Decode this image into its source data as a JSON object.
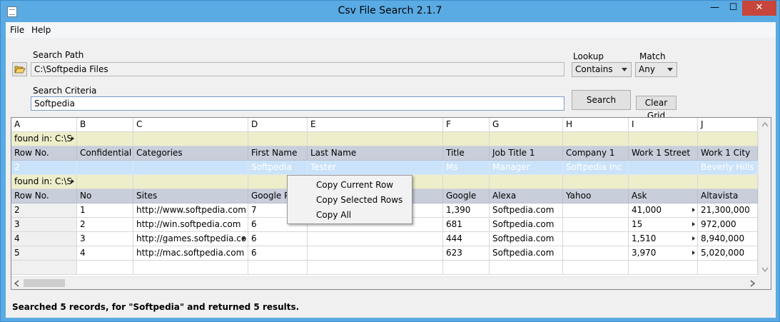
{
  "window": {
    "title": "Csv File Search 2.1.7",
    "min": "—",
    "max": "☐",
    "close": "✕"
  },
  "menu": [
    "File",
    "Help"
  ],
  "search_path": {
    "label": "Search Path",
    "value": "C:\\Softpedia Files"
  },
  "search_criteria": {
    "label": "Search Criteria",
    "value": "Softpedia"
  },
  "lookup": {
    "label": "Lookup",
    "value": "Contains"
  },
  "match": {
    "label": "Match",
    "value": "Any"
  },
  "buttons": {
    "search": "Search",
    "clear_grid": "Clear Grid"
  },
  "grid": {
    "column_letters": [
      "A",
      "B",
      "C",
      "D",
      "E",
      "F",
      "G",
      "H",
      "I",
      "J"
    ],
    "group1": {
      "label": "found in: C:\\S",
      "headers": [
        "Row No.",
        "Confidential",
        "Categories",
        "First Name",
        "Last Name",
        "Title",
        "Job Title 1",
        "Company 1",
        "Work 1 Street",
        "Work 1 City"
      ],
      "rows": [
        [
          "2",
          "",
          "",
          "Softpedia",
          "Tester",
          "Ms",
          "Manager",
          "Softpedia Inc",
          "",
          "Beverly Hills"
        ]
      ]
    },
    "group2": {
      "label": "found in: C:\\S",
      "headers": [
        "Row No.",
        "No",
        "Sites",
        "Google PR",
        "",
        "Google",
        "Alexa",
        "Yahoo",
        "Ask",
        "Altavista"
      ],
      "rows": [
        [
          "2",
          "1",
          "http://www.softpedia.com",
          "7",
          "",
          "1,390",
          "Softpedia.com",
          "",
          "41,000",
          "21,300,000"
        ],
        [
          "3",
          "2",
          "http://win.softpedia.com",
          "6",
          "",
          "681",
          "Softpedia.com",
          "",
          "15",
          "972,000"
        ],
        [
          "4",
          "3",
          "http://games.softpedia.co",
          "6",
          "",
          "444",
          "Softpedia.com",
          "",
          "1,510",
          "8,940,000"
        ],
        [
          "5",
          "4",
          "http://mac.softpedia.com",
          "6",
          "",
          "623",
          "Softpedia.com",
          "",
          "3,970",
          "5,020,000"
        ]
      ]
    }
  },
  "context_menu": [
    "Copy Current Row",
    "Copy Selected Rows",
    "Copy All"
  ],
  "status": "Searched 5 records, for \"Softpedia\" and returned 5 results."
}
